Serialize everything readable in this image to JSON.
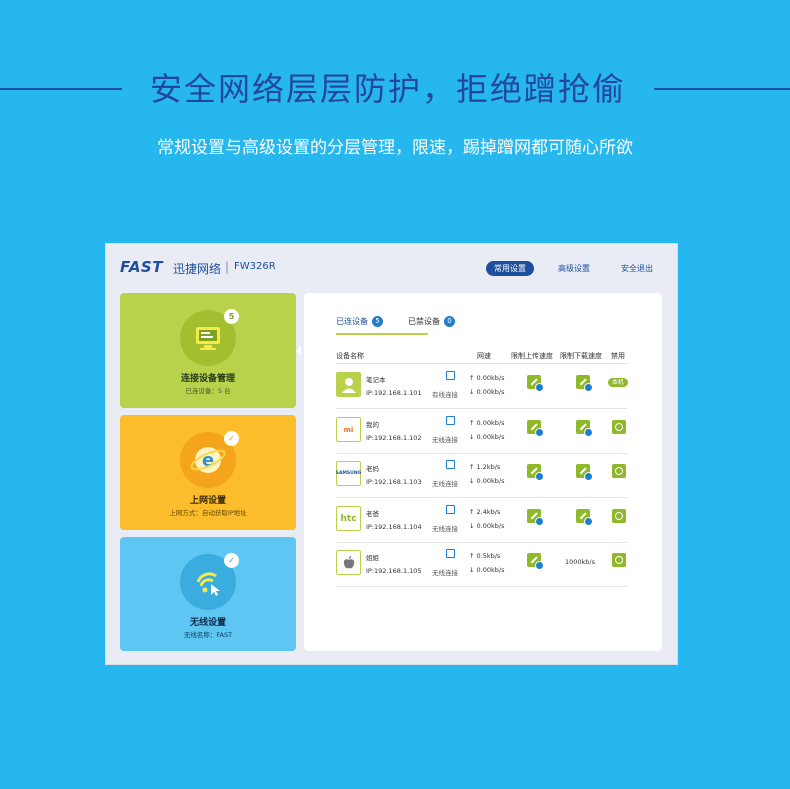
{
  "page": {
    "headline": "安全网络层层防护，拒绝蹭抢偷",
    "subline": "常规设置与高级设置的分层管理，限速，踢掉蹭网都可随心所欲"
  },
  "router": {
    "brand": "FAST",
    "brand_cn": "迅捷网络",
    "separator": "|",
    "model": "FW326R",
    "nav": [
      "常用设置",
      "高级设置",
      "安全退出"
    ]
  },
  "cards": [
    {
      "title": "连接设备管理",
      "subtitle": "已连设备：5 台",
      "badge": "5",
      "icon": "monitor-icon"
    },
    {
      "title": "上网设置",
      "subtitle": "上网方式：自动获取IP地址",
      "badge": "✓",
      "icon": "internet-explorer-icon"
    },
    {
      "title": "无线设置",
      "subtitle": "无线名称：FAST",
      "badge": "✓",
      "icon": "wifi-icon"
    }
  ],
  "device_panel": {
    "tabs": [
      {
        "label": "已连设备",
        "count": "5"
      },
      {
        "label": "已禁设备",
        "count": "0"
      }
    ],
    "columns": [
      "设备名称",
      "网速",
      "限制上传速度",
      "限制下载速度",
      "禁用"
    ],
    "devices": [
      {
        "name": "笔记本",
        "ip": "IP:192.168.1.101",
        "connection": "有线连接",
        "up": "↑ 0.00kb/s",
        "down": "↓ 0.00kb/s",
        "icon_label": "",
        "ban": "本机"
      },
      {
        "name": "我的",
        "ip": "IP:192.168.1.102",
        "connection": "无线连接",
        "up": "↑ 0.00kb/s",
        "down": "↓ 0.00kb/s",
        "icon_label": "mi"
      },
      {
        "name": "老妈",
        "ip": "IP:192.168.1.103",
        "connection": "无线连接",
        "up": "↑ 1.2kb/s",
        "down": "↓ 0.00kb/s",
        "icon_label": "SAMSUNG"
      },
      {
        "name": "老爸",
        "ip": "IP:192.168.1.104",
        "connection": "无线连接",
        "up": "↑ 2.4kb/s",
        "down": "↓ 0.00kb/s",
        "icon_label": "htc"
      },
      {
        "name": "姐姐",
        "ip": "IP:192.168.1.105",
        "connection": "无线连接",
        "up": "↑ 0.5kb/s",
        "down": "↓ 0.00kb/s",
        "icon_label": "",
        "download_limit": "1000kb/s"
      }
    ]
  }
}
